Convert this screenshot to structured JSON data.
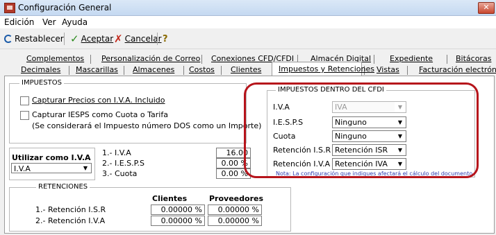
{
  "window": {
    "title": "Configuración General",
    "close_label": "✕"
  },
  "menu": {
    "items": [
      "Edición",
      "Ver",
      "Ayuda"
    ]
  },
  "toolbar": {
    "restablecer": "Restablecer",
    "aceptar": "Aceptar",
    "cancelar": "Cancelar"
  },
  "tabs": {
    "row1": [
      "Complementos",
      "Personalización de Correo",
      "Conexiones CFD/CFDI",
      "Almacén Digital",
      "Expediente",
      "Bitácoras"
    ],
    "row2": [
      "Decimales",
      "Mascarillas",
      "Almacenes",
      "Costos",
      "Clientes",
      "Impuestos y Retenciones",
      "Vistas",
      "Facturación electrónica"
    ]
  },
  "impuestos": {
    "title": "IMPUESTOS",
    "check1": "Capturar Precios con I.V.A. Incluido",
    "check2": "Capturar IESPS como Cuota o Tarifa",
    "check2_note": "(Se considerará el Impuesto número DOS como un Importe)"
  },
  "utilizar": {
    "label": "Utilizar como I.V.A",
    "value": "I.V.A"
  },
  "rates": [
    {
      "label": "1.- I.V.A",
      "value": "16.00 %"
    },
    {
      "label": "2.- I.E.S.P.S",
      "value": "0.00 %"
    },
    {
      "label": "3.- Cuota",
      "value": "0.00 %"
    }
  ],
  "cfdi": {
    "title": "IMPUESTOS DENTRO DEL CFDI",
    "rows": [
      {
        "label": "I.V.A",
        "value": "IVA",
        "disabled": true
      },
      {
        "label": "I.E.S.P.S",
        "value": "Ninguno"
      },
      {
        "label": "Cuota",
        "value": "Ninguno"
      },
      {
        "label": "Retención I.S.R",
        "value": "Retención ISR"
      },
      {
        "label": "Retención I.V.A",
        "value": "Retención IVA"
      }
    ],
    "note": "Nota: La configuración que indiques afectará el cálculo del documento"
  },
  "retenciones": {
    "title": "RETENCIONES",
    "col_clientes": "Clientes",
    "col_proveedores": "Proveedores",
    "rows": [
      {
        "label": "1.- Retención I.S.R",
        "clientes": "0.00000 %",
        "proveedores": "0.00000 %"
      },
      {
        "label": "2.- Retención I.V.A",
        "clientes": "0.00000 %",
        "proveedores": "0.00000 %"
      }
    ]
  },
  "colors": {
    "highlight": "#b6141b",
    "note": "#2e3bb0"
  }
}
